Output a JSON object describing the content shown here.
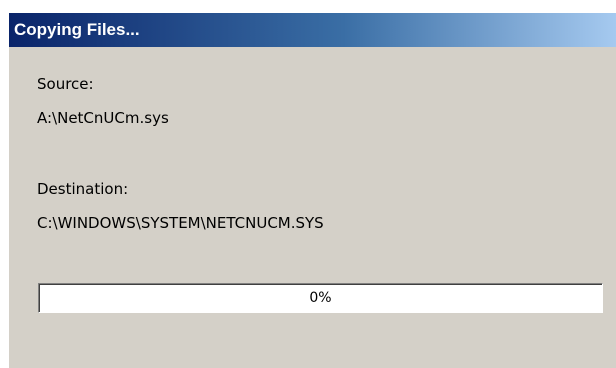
{
  "window": {
    "title": "Copying Files..."
  },
  "source": {
    "label": "Source:",
    "value": "A:\\NetCnUCm.sys"
  },
  "destination": {
    "label": "Destination:",
    "value": "C:\\WINDOWS\\SYSTEM\\NETCNUCM.SYS"
  },
  "progress": {
    "percent": 0,
    "text": "0%"
  },
  "colors": {
    "face": "#d4d0c8",
    "titlebar_start": "#0a246a",
    "titlebar_end": "#a6caf0",
    "title_text": "#ffffff"
  }
}
